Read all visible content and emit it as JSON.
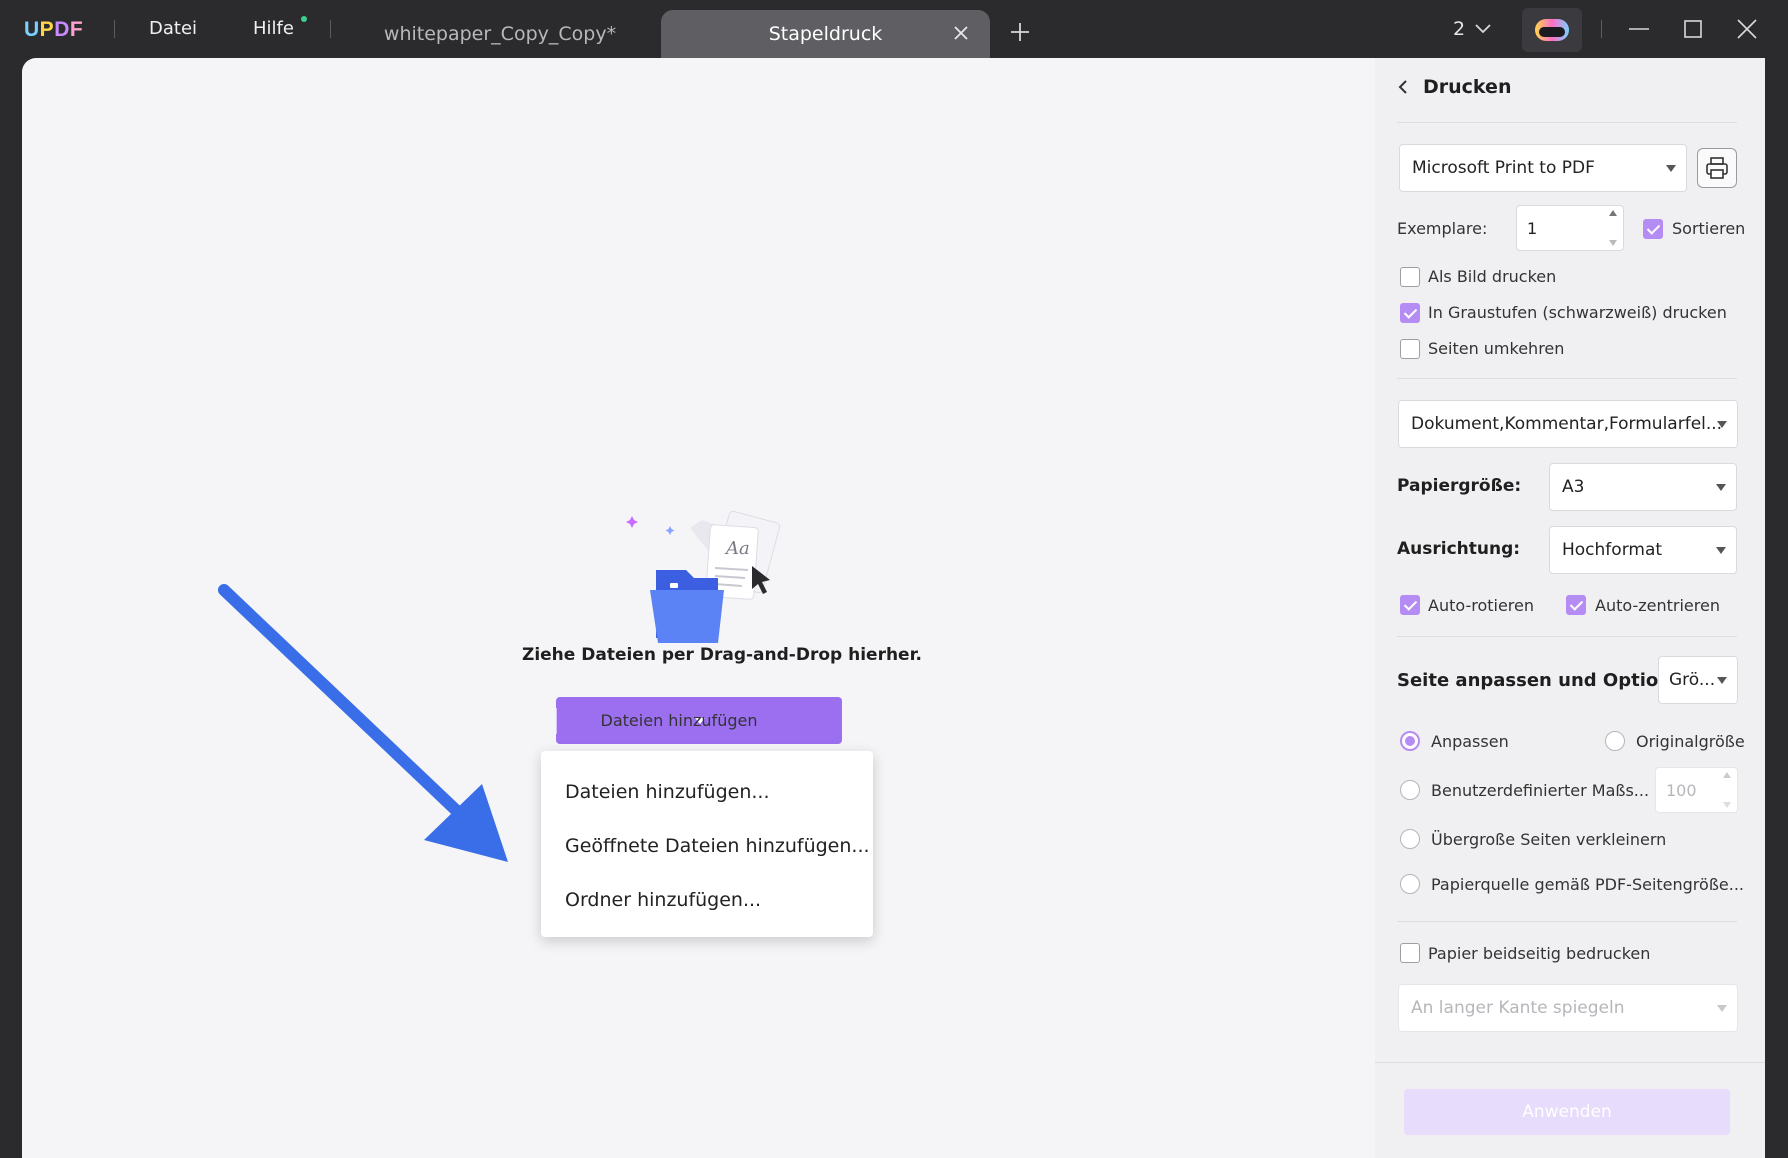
{
  "titlebar": {
    "logo": {
      "u": "U",
      "p": "P",
      "d": "D",
      "f": "F"
    },
    "menu": {
      "file": "Datei",
      "help": "Hilfe"
    },
    "tabs": [
      {
        "label": "whitepaper_Copy_Copy*",
        "active": false
      },
      {
        "label": "Stapeldruck",
        "active": true
      }
    ],
    "page_count": "2"
  },
  "main": {
    "drop_text": "Ziehe Dateien per Drag-and-Drop hierher.",
    "add_button_label": "Dateien hinzufügen",
    "dropdown_items": [
      "Dateien hinzufügen...",
      "Geöffnete Dateien hinzufügen...",
      "Ordner hinzufügen..."
    ],
    "illustration_text": "Aa"
  },
  "panel": {
    "title": "Drucken",
    "printer": "Microsoft Print to PDF",
    "copies_label": "Exemplare:",
    "copies_value": "1",
    "collate_label": "Sortieren",
    "collate_checked": true,
    "options": [
      {
        "label": "Als Bild drucken",
        "checked": false
      },
      {
        "label": "In Graustufen (schwarzweiß) drucken",
        "checked": true
      },
      {
        "label": "Seiten umkehren",
        "checked": false
      }
    ],
    "content_select": "Dokument,Kommentar,Formularfel...",
    "paper_size_label": "Papiergröße:",
    "paper_size": "A3",
    "orientation_label": "Ausrichtung:",
    "orientation": "Hochformat",
    "auto_rotate_label": "Auto-rotieren",
    "auto_rotate_checked": true,
    "auto_center_label": "Auto-zentrieren",
    "auto_center_checked": true,
    "fit_section_label": "Seite anpassen und Optio...",
    "fit_select": "Grö...",
    "fit_options": {
      "fit": "Anpassen",
      "original": "Originalgröße",
      "custom": "Benutzerdefinierter Maßs...",
      "shrink": "Übergroße Seiten verkleinern",
      "paper_source": "Papierquelle gemäß PDF-Seitengröße..."
    },
    "fit_selected": "fit",
    "scale_value": "100",
    "duplex_label": "Papier beidseitig bedrucken",
    "duplex_checked": false,
    "duplex_mode": "An langer Kante spiegeln",
    "apply_label": "Anwenden"
  },
  "colors": {
    "accent": "#9b6ff0",
    "checkbox": "#b58cf3",
    "arrow": "#3a6ee8",
    "titlebar_bg": "#2b2b2e"
  }
}
